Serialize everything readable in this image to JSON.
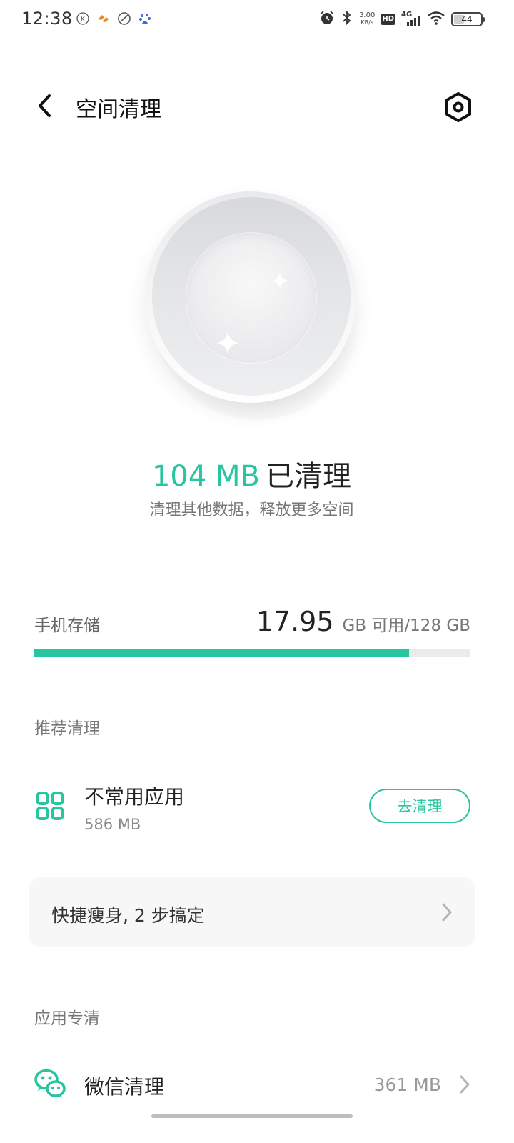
{
  "status_bar": {
    "time": "12:38",
    "notifications": [
      "k-app-icon",
      "taobao-icon",
      "feather-app-icon",
      "baidu-icon"
    ],
    "net_speed": "3.00",
    "net_speed_unit": "KB/s",
    "hd_label": "HD",
    "network": "4G",
    "battery_level": "44",
    "battery_percent": 44
  },
  "header": {
    "title": "空间清理",
    "back_icon": "chevron-left-icon",
    "settings_icon": "settings-icon"
  },
  "result": {
    "amount": "104 MB",
    "label": "已清理",
    "subtitle": "清理其他数据，释放更多空间"
  },
  "storage": {
    "label": "手机存储",
    "free": "17.95",
    "unit_text": "GB 可用/128 GB",
    "used_fraction": 0.86
  },
  "recommended": {
    "section_title": "推荐清理",
    "items": [
      {
        "icon": "app-grid-icon",
        "title": "不常用应用",
        "size": "586 MB",
        "action": "去清理"
      }
    ],
    "quick_tip": "快捷瘦身, 2 步搞定"
  },
  "app_clean": {
    "section_title": "应用专清",
    "items": [
      {
        "icon": "wechat-icon",
        "title": "微信清理",
        "size": "361 MB"
      }
    ]
  },
  "colors": {
    "accent": "#27c5a0",
    "bar_track": "#ebebeb",
    "card_bg": "#f7f7f7"
  }
}
